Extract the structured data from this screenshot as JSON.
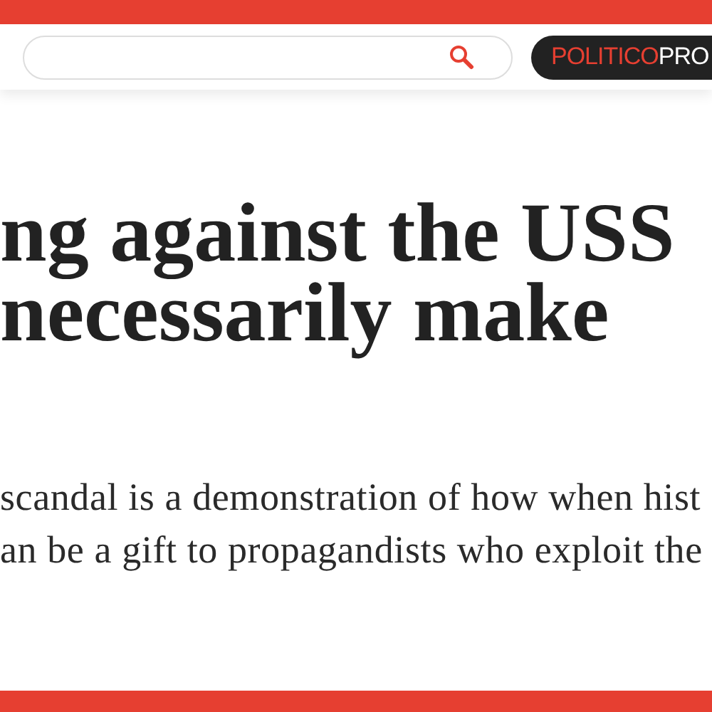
{
  "logo": {
    "brand": "POLITICO",
    "tier": "PRO"
  },
  "headline": [
    "ng against the USS",
    "necessarily make"
  ],
  "summary": [
    "scandal is a demonstration of how when hist",
    "an be a gift to propagandists who exploit the"
  ]
}
